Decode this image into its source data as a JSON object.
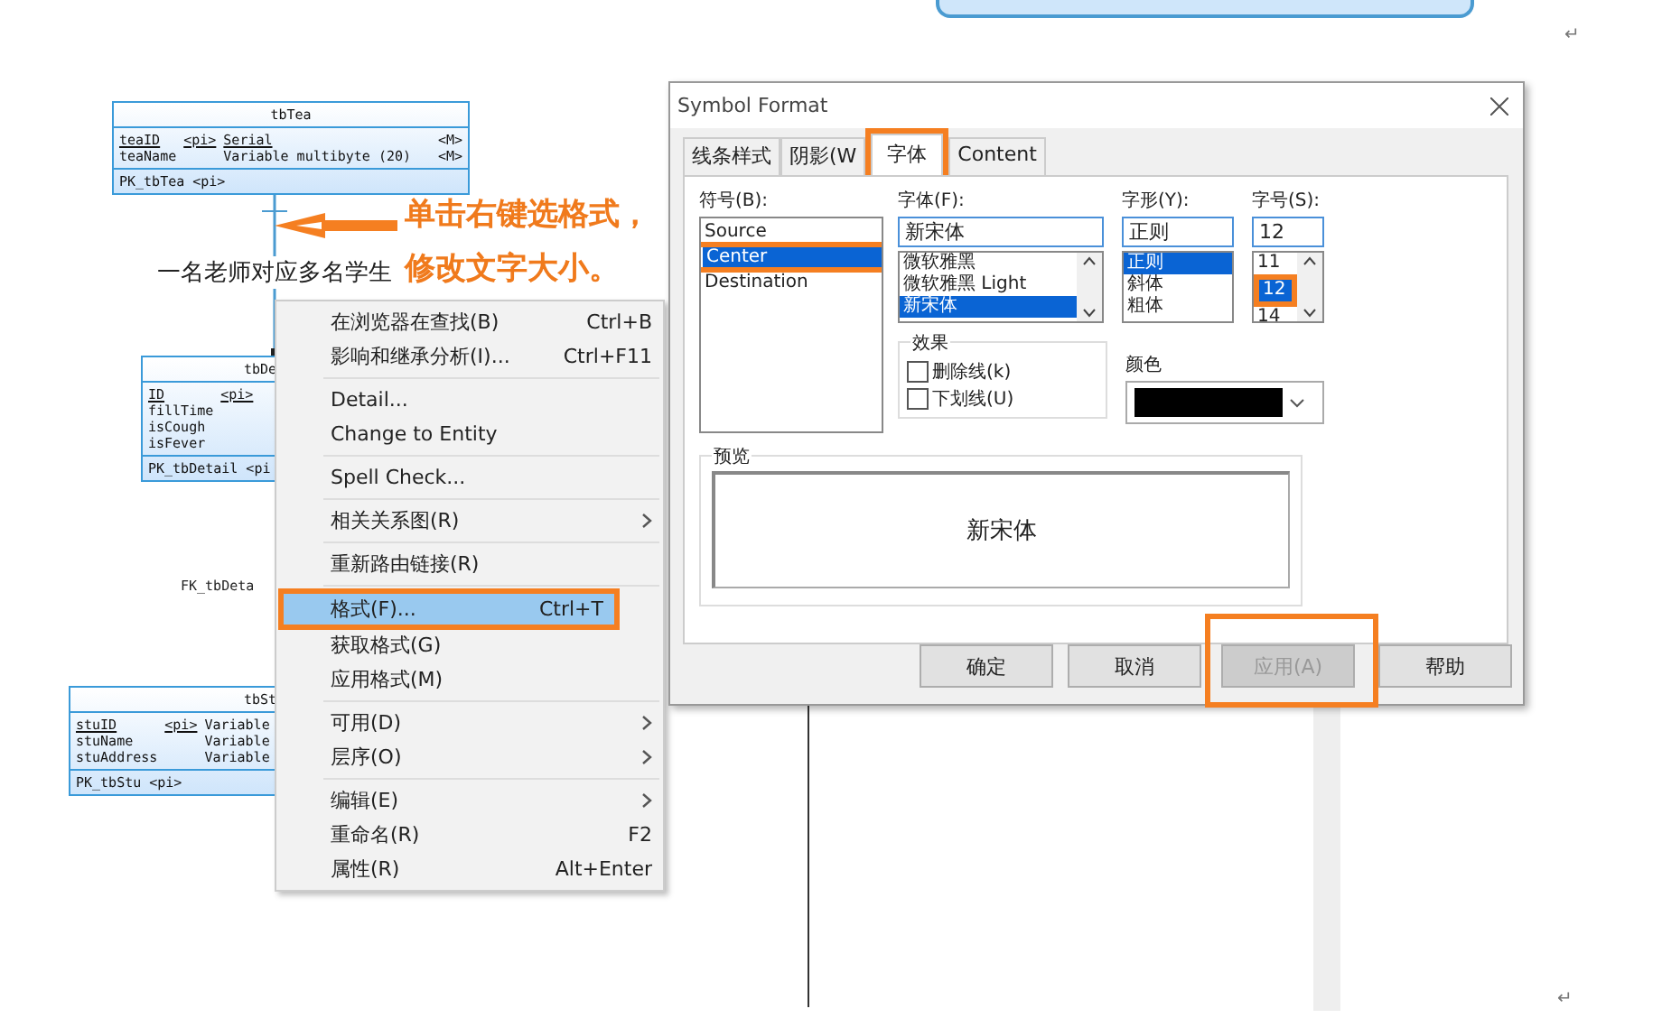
{
  "paragraph_marks": [
    "↵",
    "↵"
  ],
  "diagram": {
    "entities": [
      {
        "title": "tbTea",
        "attributes": [
          {
            "name": "teaID",
            "key": "<pi>",
            "type": "Serial",
            "mandatory": "<M>"
          },
          {
            "name": "teaName",
            "type": "Variable multibyte (20)",
            "mandatory": "<M>"
          }
        ],
        "identifier": "PK_tbTea  <pi>"
      },
      {
        "title": "tbDe",
        "attributes": [
          {
            "name": "ID",
            "key": "<pi>"
          },
          {
            "name": "fillTime"
          },
          {
            "name": "isCough"
          },
          {
            "name": "isFever"
          }
        ],
        "identifier": "PK_tbDetail  <pi"
      },
      {
        "title": "tbSt",
        "attributes": [
          {
            "name": "stuID",
            "key": "<pi>",
            "type": "Variable"
          },
          {
            "name": "stuName",
            "type": "Variable"
          },
          {
            "name": "stuAddress",
            "type": "Variable"
          }
        ],
        "identifier": "PK_tbStu  <pi>"
      }
    ],
    "relationship_label": "一名老师对应多名学生",
    "reference_label": "FK_tbDeta"
  },
  "annotation": {
    "lines": [
      "单击右键选格式，",
      "修改文字大小。"
    ]
  },
  "context_menu": {
    "groups": [
      [
        {
          "label": "在浏览器在查找(B)",
          "shortcut": "Ctrl+B",
          "submenu": false,
          "selected": false,
          "highlighted": false
        },
        {
          "label": "影响和继承分析(I)...",
          "shortcut": "Ctrl+F11",
          "submenu": false,
          "selected": false,
          "highlighted": false
        }
      ],
      [
        {
          "label": "Detail...",
          "submenu": false,
          "selected": false,
          "highlighted": false
        },
        {
          "label": "Change to Entity",
          "submenu": false,
          "selected": false,
          "highlighted": false
        }
      ],
      [
        {
          "label": "Spell Check...",
          "submenu": false,
          "selected": false,
          "highlighted": false
        }
      ],
      [
        {
          "label": "相关关系图(R)",
          "submenu": true,
          "selected": false,
          "highlighted": false
        }
      ],
      [
        {
          "label": "重新路由链接(R)",
          "submenu": false,
          "selected": false,
          "highlighted": false
        }
      ],
      [
        {
          "label": "格式(F)...",
          "shortcut": "Ctrl+T",
          "submenu": false,
          "selected": true,
          "highlighted": true
        },
        {
          "label": "获取格式(G)",
          "submenu": false,
          "selected": false,
          "highlighted": false
        },
        {
          "label": "应用格式(M)",
          "submenu": false,
          "selected": false,
          "highlighted": false
        }
      ],
      [
        {
          "label": "可用(D)",
          "submenu": true,
          "selected": false,
          "highlighted": false
        },
        {
          "label": "层序(O)",
          "submenu": true,
          "selected": false,
          "highlighted": false
        }
      ],
      [
        {
          "label": "编辑(E)",
          "submenu": true,
          "selected": false,
          "highlighted": false
        },
        {
          "label": "重命名(R)",
          "shortcut": "F2",
          "submenu": false,
          "selected": false,
          "highlighted": false
        },
        {
          "label": "属性(R)",
          "shortcut": "Alt+Enter",
          "submenu": false,
          "selected": false,
          "highlighted": false
        }
      ]
    ]
  },
  "dialog": {
    "title": "Symbol Format",
    "tabs": [
      {
        "label": "线条样式",
        "selected": false,
        "highlighted": false
      },
      {
        "label": "阴影(W",
        "selected": false,
        "highlighted": false
      },
      {
        "label": "字体",
        "selected": true,
        "highlighted": true
      },
      {
        "label": "Content",
        "selected": false,
        "highlighted": false
      }
    ],
    "symbol": {
      "label": "符号(B):",
      "items": [
        {
          "label": "Source",
          "selected": false,
          "highlighted": false
        },
        {
          "label": "Center",
          "selected": true,
          "highlighted": true
        },
        {
          "label": "Destination",
          "selected": false,
          "highlighted": false
        }
      ]
    },
    "font": {
      "label": "字体(F):",
      "value": "新宋体",
      "items": [
        {
          "label": "微软雅黑",
          "selected": false,
          "highlighted": false
        },
        {
          "label": "微软雅黑 Light",
          "selected": false,
          "highlighted": false
        },
        {
          "label": "新宋体",
          "selected": true,
          "highlighted": false
        }
      ]
    },
    "style": {
      "label": "字形(Y):",
      "value": "正则",
      "items": [
        {
          "label": "正则",
          "selected": true,
          "highlighted": false
        },
        {
          "label": "斜体",
          "selected": false,
          "highlighted": false
        },
        {
          "label": "粗体",
          "selected": false,
          "highlighted": false
        }
      ]
    },
    "size": {
      "label": "字号(S):",
      "value": "12",
      "items": [
        {
          "label": "11",
          "selected": false,
          "highlighted": false
        },
        {
          "label": "12",
          "selected": true,
          "highlighted": true
        },
        {
          "label": "14",
          "selected": false,
          "highlighted": false
        }
      ]
    },
    "effects": {
      "label": "效果",
      "options": [
        {
          "label": "删除线(k)",
          "checked": false
        },
        {
          "label": "下划线(U)",
          "checked": false
        }
      ]
    },
    "color": {
      "label": "颜色",
      "color": "#000000"
    },
    "preview": {
      "label": "预览",
      "text": "新宋体"
    },
    "buttons": [
      {
        "label": "确定",
        "disabled": false,
        "highlighted": false
      },
      {
        "label": "取消",
        "disabled": false,
        "highlighted": false
      },
      {
        "label": "应用(A)",
        "disabled": true,
        "highlighted": true
      },
      {
        "label": "帮助",
        "disabled": false,
        "highlighted": false
      }
    ]
  }
}
